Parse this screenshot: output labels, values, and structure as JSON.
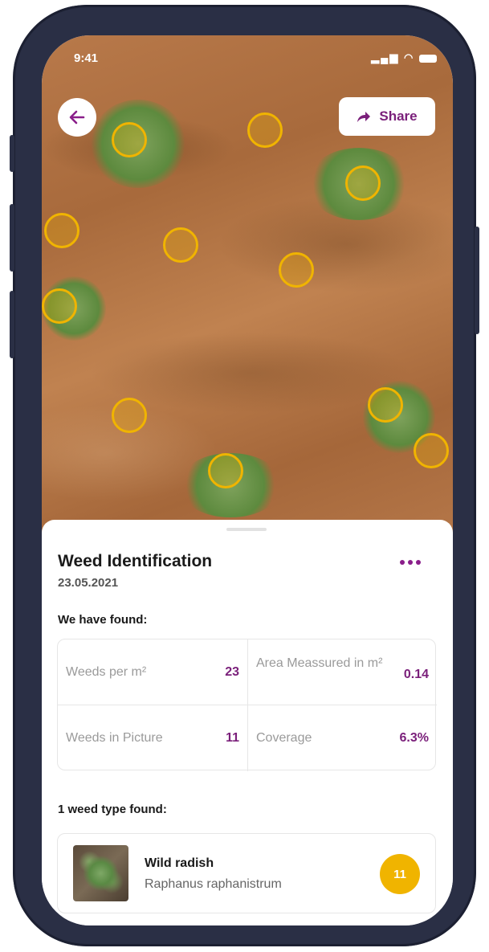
{
  "status": {
    "time": "9:41",
    "icons": "signal wifi battery"
  },
  "header": {
    "share_label": "Share"
  },
  "report": {
    "title": "Weed Identification",
    "date": "23.05.2021",
    "found_heading": "We have found:",
    "stats": [
      {
        "label": "Weeds per m²",
        "value": "23"
      },
      {
        "label": "Area Meassured in m²",
        "value": "0.14"
      },
      {
        "label": "Weeds in Picture",
        "value": "11"
      },
      {
        "label": "Coverage",
        "value": "6.3%"
      }
    ],
    "types_heading": "1 weed type found:",
    "weed_types": [
      {
        "name": "Wild radish",
        "scientific": "Raphanus raphanistrum",
        "count": "11"
      }
    ]
  },
  "colors": {
    "accent": "#7a1f7a",
    "marker": "#f0b400",
    "soil": "#b07040"
  }
}
